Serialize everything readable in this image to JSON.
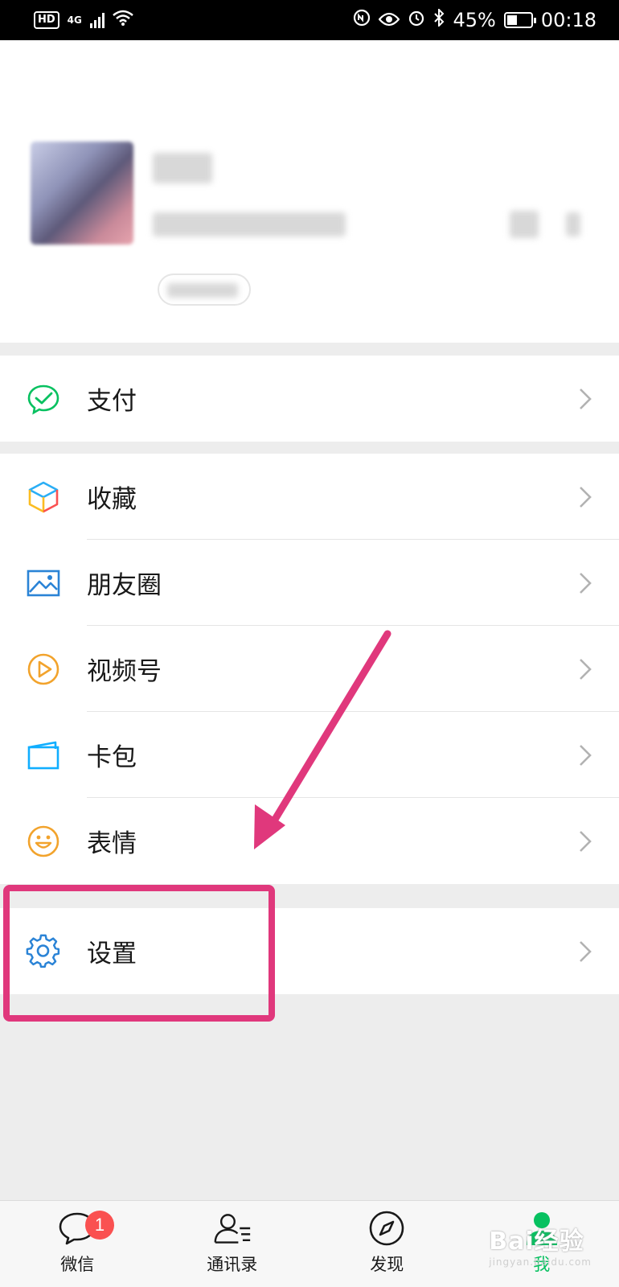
{
  "status_bar": {
    "hd": "HD",
    "network": "4G",
    "battery": "45%",
    "battery_level": 0.45,
    "time": "00:18"
  },
  "menu": {
    "pay": {
      "label": "支付",
      "icon": "wechat-pay-icon"
    },
    "items": [
      {
        "label": "收藏",
        "icon": "favorites-cube-icon"
      },
      {
        "label": "朋友圈",
        "icon": "moments-image-icon"
      },
      {
        "label": "视频号",
        "icon": "channels-play-icon"
      },
      {
        "label": "卡包",
        "icon": "card-wallet-icon"
      },
      {
        "label": "表情",
        "icon": "sticker-smile-icon"
      }
    ],
    "settings": {
      "label": "设置",
      "icon": "gear-icon"
    }
  },
  "tabs": [
    {
      "label": "微信",
      "icon": "chat-bubble-icon",
      "badge": "1",
      "active": false
    },
    {
      "label": "通讯录",
      "icon": "contacts-icon",
      "active": false
    },
    {
      "label": "发现",
      "icon": "compass-icon",
      "active": false
    },
    {
      "label": "我",
      "icon": "person-icon",
      "active": true
    }
  ],
  "watermark": {
    "text": "Bai经验",
    "sub": "jingyan.baidu.com"
  },
  "colors": {
    "accent": "#07c160",
    "annotation": "#e0387c",
    "badge": "#fa5151",
    "background": "#ededed"
  }
}
